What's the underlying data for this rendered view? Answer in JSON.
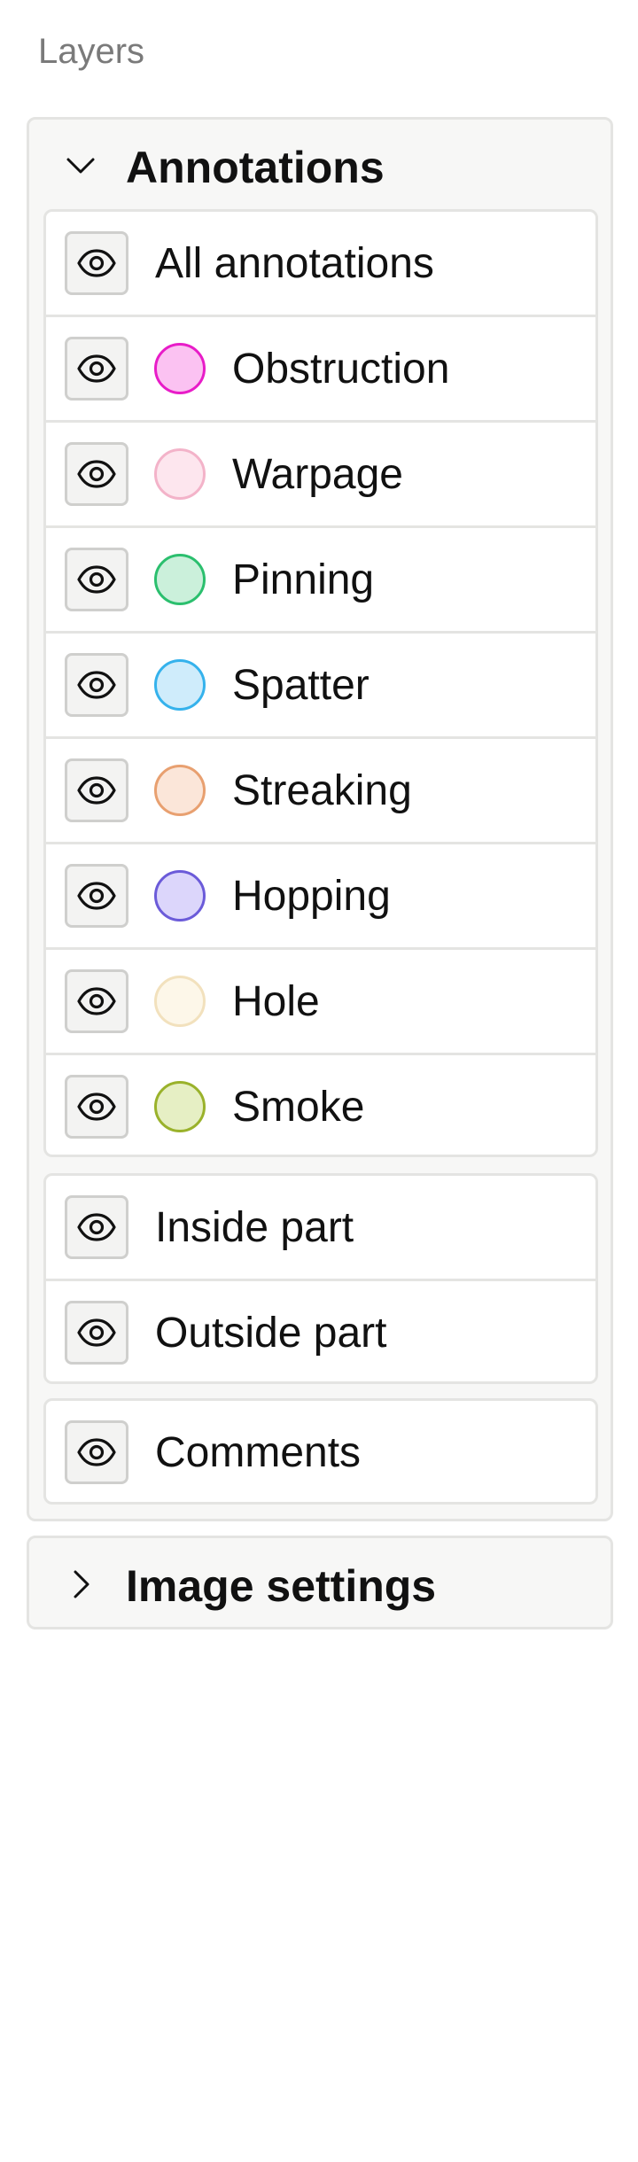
{
  "panel": {
    "title": "Layers"
  },
  "annotations": {
    "title": "Annotations",
    "expanded": true,
    "all": {
      "label": "All annotations",
      "visible": true
    },
    "items": [
      {
        "label": "Obstruction",
        "fill": "#fbc2f2",
        "stroke": "#e81cc8",
        "visible": true
      },
      {
        "label": "Warpage",
        "fill": "#fde6ee",
        "stroke": "#f3b3c9",
        "visible": true
      },
      {
        "label": "Pinning",
        "fill": "#cbf0db",
        "stroke": "#2bbf6e",
        "visible": true
      },
      {
        "label": "Spatter",
        "fill": "#cfecfb",
        "stroke": "#35b2ec",
        "visible": true
      },
      {
        "label": "Streaking",
        "fill": "#fbe6d9",
        "stroke": "#e8a070",
        "visible": true
      },
      {
        "label": "Hopping",
        "fill": "#dcd6fb",
        "stroke": "#6b5bd9",
        "visible": true
      },
      {
        "label": "Hole",
        "fill": "#fdf7e9",
        "stroke": "#f2e1bd",
        "visible": true
      },
      {
        "label": "Smoke",
        "fill": "#e6efc4",
        "stroke": "#9ab22b",
        "visible": true
      }
    ],
    "part_layers": [
      {
        "label": "Inside part",
        "visible": true
      },
      {
        "label": "Outside part",
        "visible": true
      }
    ],
    "comments": {
      "label": "Comments",
      "visible": true
    }
  },
  "image_settings": {
    "title": "Image settings",
    "expanded": false
  },
  "icons": {
    "eye": "eye-icon",
    "chevron_expanded": "chevron-down-icon",
    "chevron_collapsed": "chevron-right-icon"
  }
}
